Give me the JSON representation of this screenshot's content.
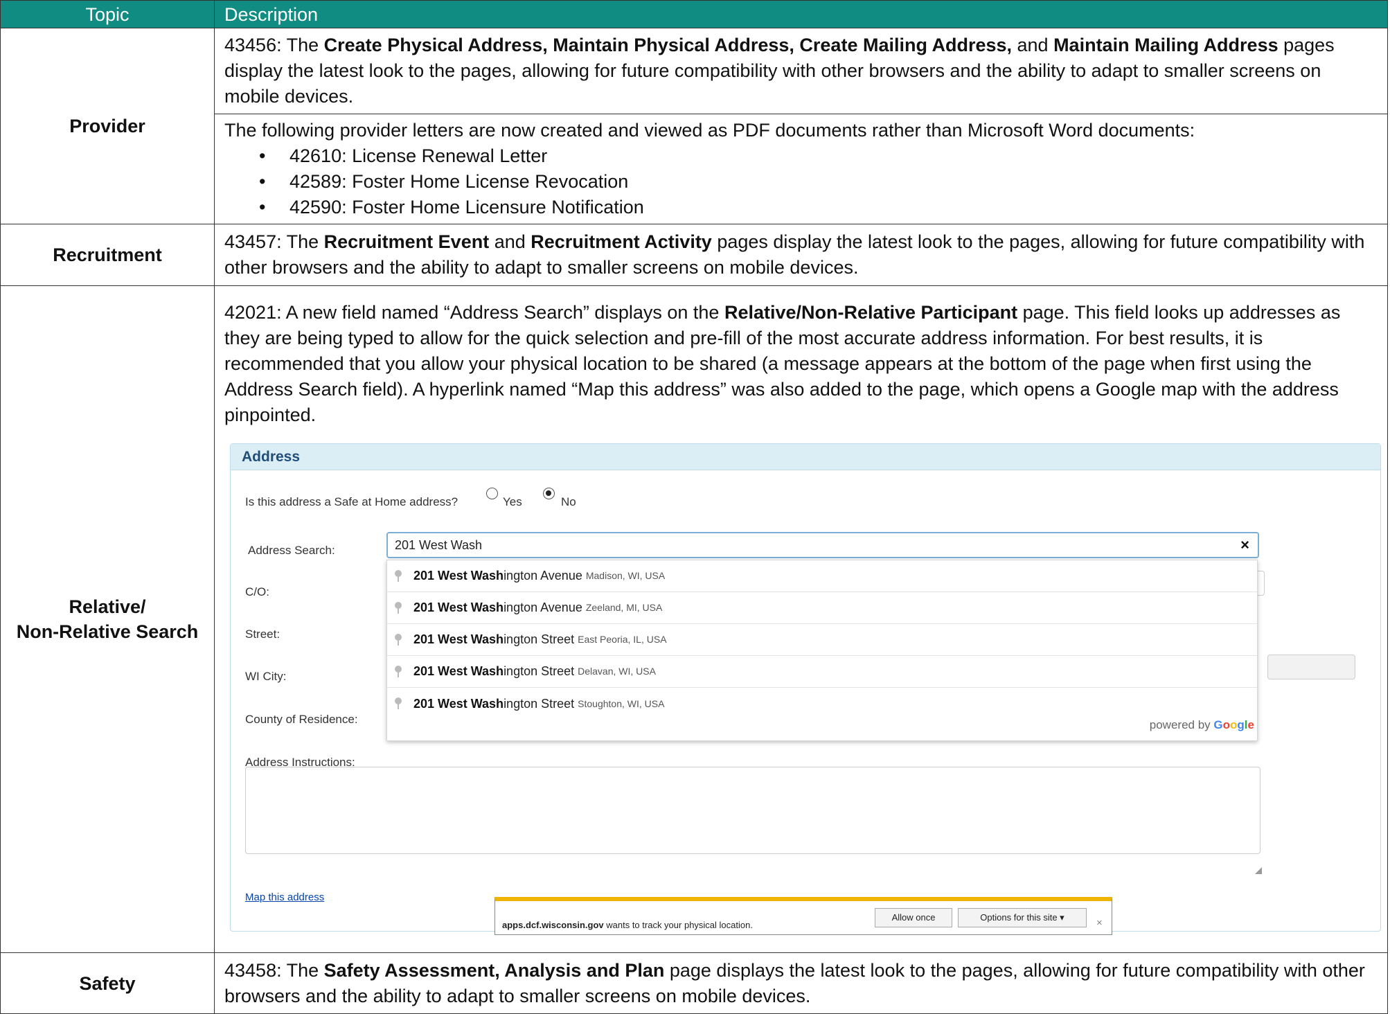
{
  "table": {
    "headers": {
      "topic": "Topic",
      "description": "Description"
    },
    "provider": {
      "topic": "Provider",
      "row1": {
        "id": "43456",
        "sep": ": The ",
        "bold1": "Create Physical Address, Maintain Physical Address, Create Mailing Address,",
        "mid": " and ",
        "bold2": "Maintain Mailing Address",
        "rest": " pages display the latest look to the pages, allowing for future compatibility with other browsers and the ability to adapt to smaller screens on mobile devices."
      },
      "row2": {
        "intro": "The following provider letters are now created and viewed as PDF documents rather than Microsoft Word documents:",
        "letters": [
          "42610: License Renewal Letter",
          "42589: Foster Home License Revocation",
          "42590: Foster Home Licensure Notification"
        ]
      }
    },
    "recruitment": {
      "topic": "Recruitment",
      "id": "43457",
      "sep": ": The ",
      "bold1": "Recruitment Event",
      "mid": " and ",
      "bold2": "Recruitment Activity",
      "rest": " pages display the latest look to the pages, allowing for future compatibility with other browsers and the ability to adapt to smaller screens on mobile devices."
    },
    "relative": {
      "topic_line1": "Relative/",
      "topic_line2": "Non-Relative Search",
      "id": "42021",
      "pre": ": A new field named “Address Search” displays on the ",
      "bold": "Relative/Non-Relative Participant",
      "rest": " page. This field looks up addresses as they are being typed to allow for the quick selection and pre-fill of the most accurate address information. For best results, it is recommended that you allow your physical location to be shared (a message appears at the bottom of the page when first using the Address Search field). A hyperlink named “Map this address” was also added to the page, which opens a Google map with the address pinpointed."
    },
    "safety": {
      "topic": "Safety",
      "id": "43458",
      "sep": ": The ",
      "bold": "Safety Assessment, Analysis and Plan",
      "rest": " page displays the latest look to the pages, allowing for future compatibility with other browsers and the ability to adapt to smaller screens on mobile devices."
    }
  },
  "screenshot": {
    "panel_title": "Address",
    "safe_question": "Is this address a Safe at Home address?",
    "radio_yes": "Yes",
    "radio_no": "No",
    "selected_radio": "No",
    "address_search_label": "Address Search:",
    "address_search_value": "201 West Wash",
    "clear_symbol": "×",
    "labels": {
      "co": "C/O:",
      "street": "Street:",
      "wi_city": "WI City:",
      "county": "County of Residence:",
      "instructions": "Address Instructions:"
    },
    "suggestions": [
      {
        "match": "201 West Wash",
        "rest": "ington Avenue",
        "secondary": "Madison, WI, USA"
      },
      {
        "match": "201 West Wash",
        "rest": "ington Avenue",
        "secondary": "Zeeland, MI, USA"
      },
      {
        "match": "201 West Wash",
        "rest": "ington Street",
        "secondary": "East Peoria, IL, USA"
      },
      {
        "match": "201 West Wash",
        "rest": "ington Street",
        "secondary": "Delavan, WI, USA"
      },
      {
        "match": "201 West Wash",
        "rest": "ington Street",
        "secondary": "Stoughton, WI, USA"
      }
    ],
    "powered_by": "powered by",
    "google": {
      "g1": "G",
      "o1": "o",
      "o2": "o",
      "g2": "g",
      "l": "l",
      "e": "e"
    },
    "map_link": "Map this address",
    "location_prompt": {
      "domain": "apps.dcf.wisconsin.gov",
      "message": " wants to track your physical location.",
      "allow": "Allow once",
      "options": "Options for this site ▾",
      "close": "×"
    }
  }
}
